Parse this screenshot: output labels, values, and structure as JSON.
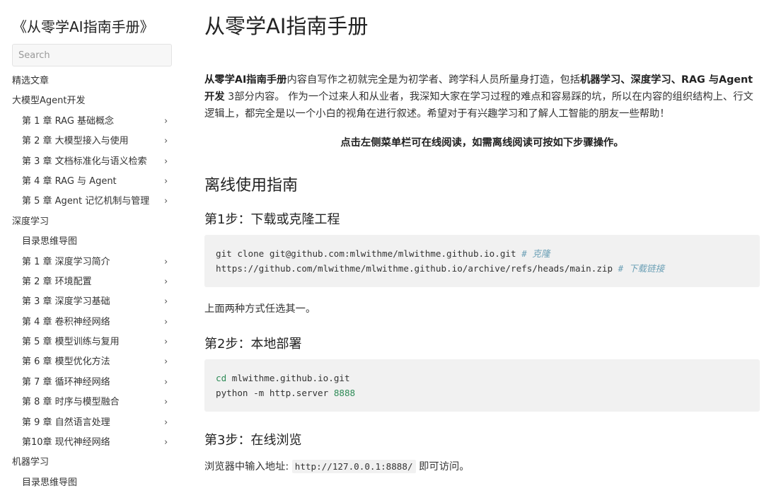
{
  "sidebar": {
    "book_title": "《从零学AI指南手册》",
    "search_placeholder": "Search",
    "items": [
      {
        "label": "精选文章",
        "level": 0,
        "chevron": false
      },
      {
        "label": "大模型Agent开发",
        "level": 0,
        "chevron": false
      },
      {
        "label": "第 1 章 RAG 基础概念",
        "level": 1,
        "chevron": true
      },
      {
        "label": "第 2 章 大模型接入与使用",
        "level": 1,
        "chevron": true
      },
      {
        "label": "第 3 章 文档标准化与语义检索",
        "level": 1,
        "chevron": true
      },
      {
        "label": "第 4 章 RAG 与 Agent",
        "level": 1,
        "chevron": true
      },
      {
        "label": "第 5 章 Agent 记忆机制与管理",
        "level": 1,
        "chevron": true
      },
      {
        "label": "深度学习",
        "level": 0,
        "chevron": false
      },
      {
        "label": "目录思维导图",
        "level": 1,
        "chevron": false
      },
      {
        "label": "第 1 章 深度学习简介",
        "level": 1,
        "chevron": true
      },
      {
        "label": "第 2 章 环境配置",
        "level": 1,
        "chevron": true
      },
      {
        "label": "第 3 章 深度学习基础",
        "level": 1,
        "chevron": true
      },
      {
        "label": "第 4 章 卷积神经网络",
        "level": 1,
        "chevron": true
      },
      {
        "label": "第 5 章 模型训练与复用",
        "level": 1,
        "chevron": true
      },
      {
        "label": "第 6 章 模型优化方法",
        "level": 1,
        "chevron": true
      },
      {
        "label": "第 7 章 循环神经网络",
        "level": 1,
        "chevron": true
      },
      {
        "label": "第 8 章 时序与模型融合",
        "level": 1,
        "chevron": true
      },
      {
        "label": "第 9 章 自然语言处理",
        "level": 1,
        "chevron": true
      },
      {
        "label": "第10章 现代神经网络",
        "level": 1,
        "chevron": true
      },
      {
        "label": "机器学习",
        "level": 0,
        "chevron": false
      },
      {
        "label": "目录思维导图",
        "level": 1,
        "chevron": false
      }
    ],
    "chevron_glyph": "›"
  },
  "main": {
    "title": "从零学AI指南手册",
    "intro": {
      "bold_1": "从零学AI指南手册",
      "text_1": "内容自写作之初就完全是为初学者、跨学科人员所量身打造，包括",
      "bold_2": "机器学习、深度学习、RAG 与Agent开发",
      "text_2": " 3部分内容。 作为一个过来人和从业者，我深知大家在学习过程的难点和容易踩的坑，所以在内容的组织结构上、行文逻辑上，都完全是以一个小白的视角在进行叙述。希望对于有兴趣学习和了解人工智能的朋友一些帮助！"
    },
    "notice": "点击左侧菜单栏可在线阅读，如需离线阅读可按如下步骤操作。",
    "offline_heading": "离线使用指南",
    "step1": {
      "heading": "第1步：下载或克隆工程",
      "code_line1_cmd": "git clone git@github.com:mlwithme/mlwithme.github.io.git",
      "code_line1_comment": "# 克隆",
      "code_line2_cmd": "https://github.com/mlwithme/mlwithme.github.io/archive/refs/heads/main.zip",
      "code_line2_comment": "# 下载链接",
      "note": "上面两种方式任选其一。"
    },
    "step2": {
      "heading": "第2步：本地部署",
      "code_line1_kw": "cd",
      "code_line1_rest": " mlwithme.github.io.git",
      "code_line2_cmd": "python -m http.server ",
      "code_line2_num": "8888"
    },
    "step3": {
      "heading": "第3步：在线浏览",
      "text_before": "浏览器中输入地址: ",
      "url": "http://127.0.0.1:8888/",
      "text_after": " 即可访问。"
    }
  }
}
